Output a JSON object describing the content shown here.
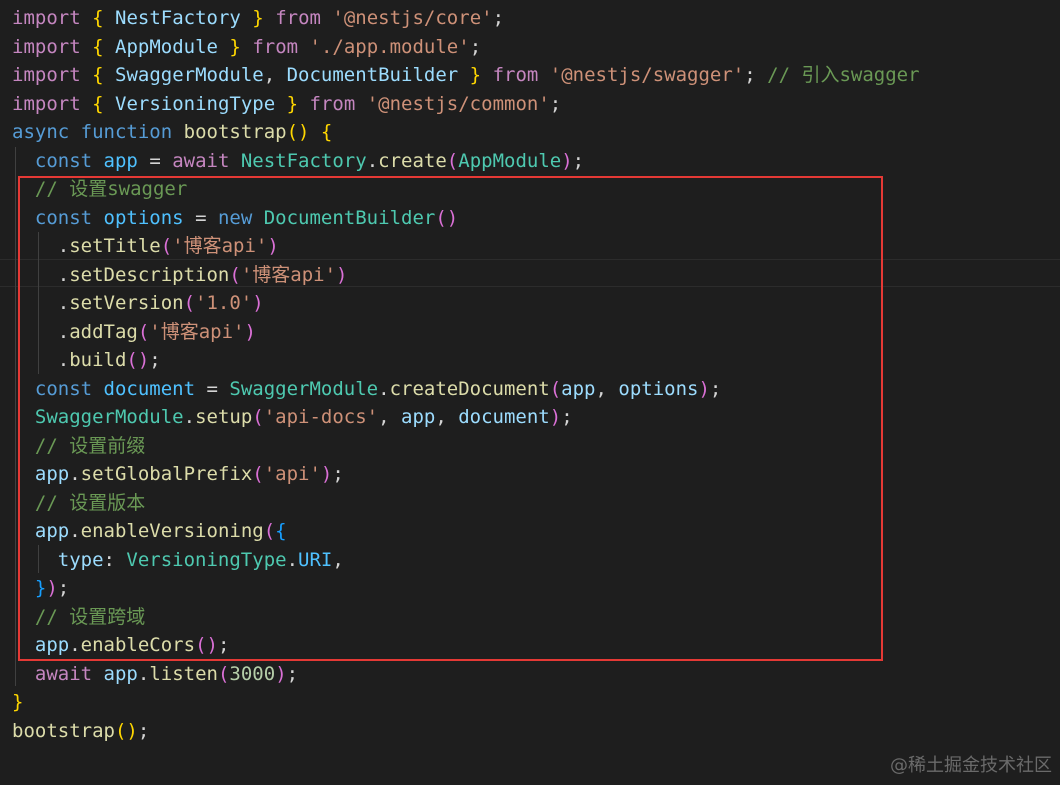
{
  "editor": {
    "theme_colors": {
      "background": "#1e1e1e",
      "keyword": "#c586c0",
      "storage": "#569cd6",
      "class": "#4ec9b0",
      "variable": "#9cdcfe",
      "constant": "#4fc1ff",
      "function": "#dcdcaa",
      "string": "#ce9178",
      "number": "#b5cea8",
      "comment": "#6a9955",
      "bracket_1": "#ffd700",
      "bracket_2": "#da70d6",
      "bracket_3": "#179fff",
      "highlight_box": "#e53935"
    },
    "lines": [
      [
        [
          "kw",
          "import"
        ],
        [
          "pu",
          " "
        ],
        [
          "b1",
          "{"
        ],
        [
          "pu",
          " "
        ],
        [
          "var",
          "NestFactory"
        ],
        [
          "pu",
          " "
        ],
        [
          "b1",
          "}"
        ],
        [
          "pu",
          " "
        ],
        [
          "kw",
          "from"
        ],
        [
          "pu",
          " "
        ],
        [
          "str",
          "'@nestjs/core'"
        ],
        [
          "pu",
          ";"
        ]
      ],
      [
        [
          "kw",
          "import"
        ],
        [
          "pu",
          " "
        ],
        [
          "b1",
          "{"
        ],
        [
          "pu",
          " "
        ],
        [
          "var",
          "AppModule"
        ],
        [
          "pu",
          " "
        ],
        [
          "b1",
          "}"
        ],
        [
          "pu",
          " "
        ],
        [
          "kw",
          "from"
        ],
        [
          "pu",
          " "
        ],
        [
          "str",
          "'./app.module'"
        ],
        [
          "pu",
          ";"
        ]
      ],
      [
        [
          "kw",
          "import"
        ],
        [
          "pu",
          " "
        ],
        [
          "b1",
          "{"
        ],
        [
          "pu",
          " "
        ],
        [
          "var",
          "SwaggerModule"
        ],
        [
          "pu",
          ", "
        ],
        [
          "var",
          "DocumentBuilder"
        ],
        [
          "pu",
          " "
        ],
        [
          "b1",
          "}"
        ],
        [
          "pu",
          " "
        ],
        [
          "kw",
          "from"
        ],
        [
          "pu",
          " "
        ],
        [
          "str",
          "'@nestjs/swagger'"
        ],
        [
          "pu",
          "; "
        ],
        [
          "cmt",
          "// 引入swagger"
        ]
      ],
      [
        [
          "kw",
          "import"
        ],
        [
          "pu",
          " "
        ],
        [
          "b1",
          "{"
        ],
        [
          "pu",
          " "
        ],
        [
          "var",
          "VersioningType"
        ],
        [
          "pu",
          " "
        ],
        [
          "b1",
          "}"
        ],
        [
          "pu",
          " "
        ],
        [
          "kw",
          "from"
        ],
        [
          "pu",
          " "
        ],
        [
          "str",
          "'@nestjs/common'"
        ],
        [
          "pu",
          ";"
        ]
      ],
      [
        [
          "st",
          "async"
        ],
        [
          "pu",
          " "
        ],
        [
          "st",
          "function"
        ],
        [
          "pu",
          " "
        ],
        [
          "fn",
          "bootstrap"
        ],
        [
          "b1",
          "()"
        ],
        [
          "pu",
          " "
        ],
        [
          "b1",
          "{"
        ]
      ],
      [
        [
          "pu",
          "  "
        ],
        [
          "st",
          "const"
        ],
        [
          "pu",
          " "
        ],
        [
          "cst",
          "app"
        ],
        [
          "pu",
          " = "
        ],
        [
          "kw",
          "await"
        ],
        [
          "pu",
          " "
        ],
        [
          "cls",
          "NestFactory"
        ],
        [
          "pu",
          "."
        ],
        [
          "fn",
          "create"
        ],
        [
          "b2",
          "("
        ],
        [
          "cls",
          "AppModule"
        ],
        [
          "b2",
          ")"
        ],
        [
          "pu",
          ";"
        ]
      ],
      [
        [
          "pu",
          "  "
        ],
        [
          "cmt",
          "// 设置swagger"
        ]
      ],
      [
        [
          "pu",
          "  "
        ],
        [
          "st",
          "const"
        ],
        [
          "pu",
          " "
        ],
        [
          "cst",
          "options"
        ],
        [
          "pu",
          " = "
        ],
        [
          "st",
          "new"
        ],
        [
          "pu",
          " "
        ],
        [
          "cls",
          "DocumentBuilder"
        ],
        [
          "b2",
          "()"
        ]
      ],
      [
        [
          "pu",
          "    ."
        ],
        [
          "fn",
          "setTitle"
        ],
        [
          "b2",
          "("
        ],
        [
          "str",
          "'博客api'"
        ],
        [
          "b2",
          ")"
        ]
      ],
      [
        [
          "pu",
          "    ."
        ],
        [
          "fn",
          "setDescription"
        ],
        [
          "b2",
          "("
        ],
        [
          "str",
          "'博客api'"
        ],
        [
          "b2",
          ")"
        ]
      ],
      [
        [
          "pu",
          "    ."
        ],
        [
          "fn",
          "setVersion"
        ],
        [
          "b2",
          "("
        ],
        [
          "str",
          "'1.0'"
        ],
        [
          "b2",
          ")"
        ]
      ],
      [
        [
          "pu",
          "    ."
        ],
        [
          "fn",
          "addTag"
        ],
        [
          "b2",
          "("
        ],
        [
          "str",
          "'博客api'"
        ],
        [
          "b2",
          ")"
        ]
      ],
      [
        [
          "pu",
          "    ."
        ],
        [
          "fn",
          "build"
        ],
        [
          "b2",
          "()"
        ],
        [
          "pu",
          ";"
        ]
      ],
      [
        [
          "pu",
          "  "
        ],
        [
          "st",
          "const"
        ],
        [
          "pu",
          " "
        ],
        [
          "cst",
          "document"
        ],
        [
          "pu",
          " = "
        ],
        [
          "cls",
          "SwaggerModule"
        ],
        [
          "pu",
          "."
        ],
        [
          "fn",
          "createDocument"
        ],
        [
          "b2",
          "("
        ],
        [
          "var",
          "app"
        ],
        [
          "pu",
          ", "
        ],
        [
          "var",
          "options"
        ],
        [
          "b2",
          ")"
        ],
        [
          "pu",
          ";"
        ]
      ],
      [
        [
          "pu",
          "  "
        ],
        [
          "cls",
          "SwaggerModule"
        ],
        [
          "pu",
          "."
        ],
        [
          "fn",
          "setup"
        ],
        [
          "b2",
          "("
        ],
        [
          "str",
          "'api-docs'"
        ],
        [
          "pu",
          ", "
        ],
        [
          "var",
          "app"
        ],
        [
          "pu",
          ", "
        ],
        [
          "var",
          "document"
        ],
        [
          "b2",
          ")"
        ],
        [
          "pu",
          ";"
        ]
      ],
      [
        [
          "pu",
          "  "
        ],
        [
          "cmt",
          "// 设置前缀"
        ]
      ],
      [
        [
          "pu",
          "  "
        ],
        [
          "var",
          "app"
        ],
        [
          "pu",
          "."
        ],
        [
          "fn",
          "setGlobalPrefix"
        ],
        [
          "b2",
          "("
        ],
        [
          "str",
          "'api'"
        ],
        [
          "b2",
          ")"
        ],
        [
          "pu",
          ";"
        ]
      ],
      [
        [
          "pu",
          "  "
        ],
        [
          "cmt",
          "// 设置版本"
        ]
      ],
      [
        [
          "pu",
          "  "
        ],
        [
          "var",
          "app"
        ],
        [
          "pu",
          "."
        ],
        [
          "fn",
          "enableVersioning"
        ],
        [
          "b2",
          "("
        ],
        [
          "b3",
          "{"
        ]
      ],
      [
        [
          "pu",
          "    "
        ],
        [
          "var",
          "type"
        ],
        [
          "pu",
          ": "
        ],
        [
          "cls",
          "VersioningType"
        ],
        [
          "pu",
          "."
        ],
        [
          "cst",
          "URI"
        ],
        [
          "pu",
          ","
        ]
      ],
      [
        [
          "pu",
          "  "
        ],
        [
          "b3",
          "}"
        ],
        [
          "b2",
          ")"
        ],
        [
          "pu",
          ";"
        ]
      ],
      [
        [
          "pu",
          "  "
        ],
        [
          "cmt",
          "// 设置跨域"
        ]
      ],
      [
        [
          "pu",
          "  "
        ],
        [
          "var",
          "app"
        ],
        [
          "pu",
          "."
        ],
        [
          "fn",
          "enableCors"
        ],
        [
          "b2",
          "()"
        ],
        [
          "pu",
          ";"
        ]
      ],
      [
        [
          "pu",
          "  "
        ],
        [
          "kw",
          "await"
        ],
        [
          "pu",
          " "
        ],
        [
          "var",
          "app"
        ],
        [
          "pu",
          "."
        ],
        [
          "fn",
          "listen"
        ],
        [
          "b2",
          "("
        ],
        [
          "num",
          "3000"
        ],
        [
          "b2",
          ")"
        ],
        [
          "pu",
          ";"
        ]
      ],
      [
        [
          "b1",
          "}"
        ]
      ],
      [
        [
          "fn",
          "bootstrap"
        ],
        [
          "b1",
          "()"
        ],
        [
          "pu",
          ";"
        ]
      ]
    ]
  },
  "watermark": "@稀土掘金技术社区"
}
